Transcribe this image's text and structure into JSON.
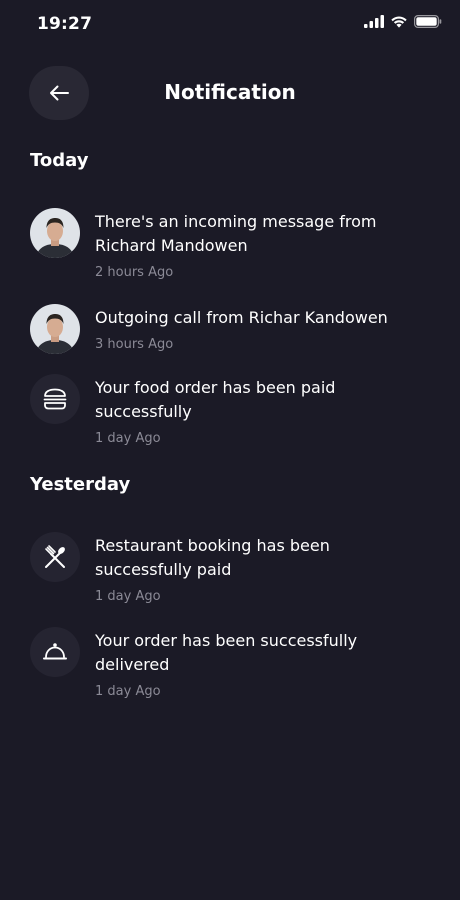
{
  "status_bar": {
    "time": "19:27",
    "icons": [
      "cellular-signal-icon",
      "wifi-icon",
      "battery-icon"
    ]
  },
  "header": {
    "back_icon": "arrow-left-icon",
    "title": "Notification"
  },
  "sections": [
    {
      "title": "Today",
      "items": [
        {
          "icon": "avatar",
          "message": "There's an incoming message from Richard Mandowen",
          "time": "2 hours Ago"
        },
        {
          "icon": "avatar",
          "message": "Outgoing call from Richar Kandowen",
          "time": "3 hours Ago"
        },
        {
          "icon": "burger-icon",
          "message": "Your food order has been paid successfully",
          "time": "1 day Ago"
        }
      ]
    },
    {
      "title": "Yesterday",
      "items": [
        {
          "icon": "utensils-icon",
          "message": "Restaurant booking has been successfully paid",
          "time": "1 day Ago"
        },
        {
          "icon": "cloche-icon",
          "message": "Your order has been successfully delivered",
          "time": "1 day Ago"
        }
      ]
    }
  ],
  "colors": {
    "background": "#1b1a26",
    "icon_circle": "#252431",
    "back_button": "#292834",
    "text": "#ffffff",
    "muted_text": "#8b8a96"
  }
}
